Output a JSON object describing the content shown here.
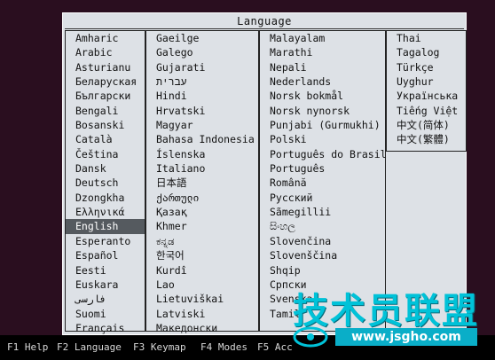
{
  "dialog": {
    "title": "Language"
  },
  "columns": [
    [
      "Amharic",
      "Arabic",
      "Asturianu",
      "Беларуская",
      "Български",
      "Bengali",
      "Bosanski",
      "Català",
      "Čeština",
      "Dansk",
      "Deutsch",
      "Dzongkha",
      "Ελληνικά",
      "English",
      "Esperanto",
      "Español",
      "Eesti",
      "Euskara",
      "فارسی",
      "Suomi",
      "Français"
    ],
    [
      "Gaeilge",
      "Galego",
      "Gujarati",
      "עברית",
      "Hindi",
      "Hrvatski",
      "Magyar",
      "Bahasa Indonesia",
      "Íslenska",
      "Italiano",
      "日本語",
      "ქართული",
      "Қазақ",
      "Khmer",
      "ಕನ್ನಡ",
      "한국어",
      "Kurdî",
      "Lao",
      "Lietuviškai",
      "Latviski",
      "Македонски"
    ],
    [
      "Malayalam",
      "Marathi",
      "Nepali",
      "Nederlands",
      "Norsk bokmål",
      "Norsk nynorsk",
      "Punjabi (Gurmukhi)",
      "Polski",
      "Português do Brasil",
      "Português",
      "Română",
      "Русский",
      "Sãmegillii",
      "සිංහල",
      "Slovenčina",
      "Slovenščina",
      "Shqip",
      "Српски",
      "Svenska",
      "Tamil",
      ""
    ],
    [
      "Thai",
      "Tagalog",
      "Türkçe",
      "Uyghur",
      "Українська",
      "Tiếng Việt",
      "中文(简体)",
      "中文(繁體)"
    ]
  ],
  "selected": "English",
  "footer": [
    {
      "key": "F1",
      "label": "Help"
    },
    {
      "key": "F2",
      "label": "Language"
    },
    {
      "key": "F3",
      "label": "Keymap"
    },
    {
      "key": "F4",
      "label": "Modes"
    },
    {
      "key": "F5",
      "label": "Acc"
    }
  ],
  "watermark": {
    "text": "技术员联盟",
    "url": "www.jsgho.com"
  },
  "colors": {
    "background": "#2a0e1f",
    "dialog": "#dde1e6",
    "selection": "#555a5f",
    "watermark": "#00c2d8"
  }
}
